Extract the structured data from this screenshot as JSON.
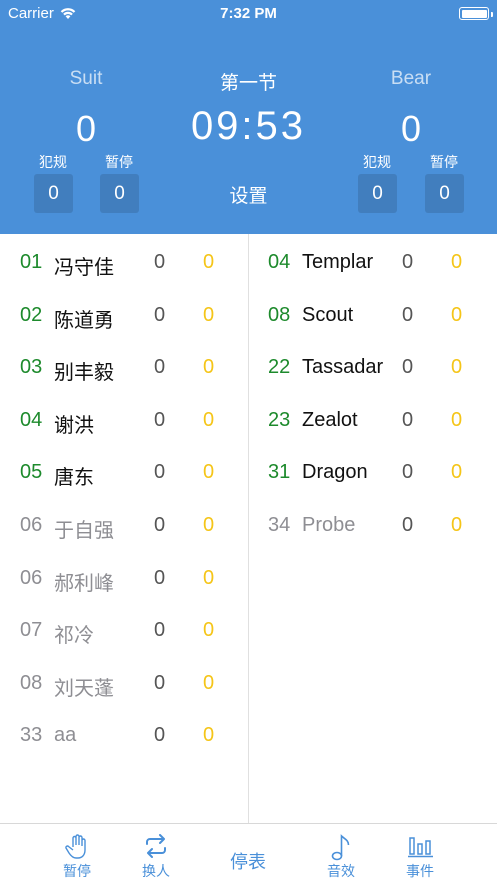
{
  "status_bar": {
    "carrier": "Carrier",
    "time": "7:32 PM"
  },
  "header": {
    "period": "第一节",
    "clock": "09:53",
    "settings_label": "设置",
    "home": {
      "name": "Suit",
      "score": "0",
      "fouls_label": "犯规",
      "fouls": "0",
      "timeouts_label": "暂停",
      "timeouts": "0"
    },
    "away": {
      "name": "Bear",
      "score": "0",
      "fouls_label": "犯规",
      "fouls": "0",
      "timeouts_label": "暂停",
      "timeouts": "0"
    }
  },
  "home_players": [
    {
      "num": "01",
      "name": "冯守佳",
      "v1": "0",
      "v2": "0",
      "active": true
    },
    {
      "num": "02",
      "name": "陈道勇",
      "v1": "0",
      "v2": "0",
      "active": true
    },
    {
      "num": "03",
      "name": "别丰毅",
      "v1": "0",
      "v2": "0",
      "active": true
    },
    {
      "num": "04",
      "name": "谢洪",
      "v1": "0",
      "v2": "0",
      "active": true
    },
    {
      "num": "05",
      "name": "唐东",
      "v1": "0",
      "v2": "0",
      "active": true
    },
    {
      "num": "06",
      "name": "于自强",
      "v1": "0",
      "v2": "0",
      "active": false
    },
    {
      "num": "06",
      "name": "郝利峰",
      "v1": "0",
      "v2": "0",
      "active": false
    },
    {
      "num": "07",
      "name": "祁冷",
      "v1": "0",
      "v2": "0",
      "active": false
    },
    {
      "num": "08",
      "name": "刘天蓬",
      "v1": "0",
      "v2": "0",
      "active": false
    },
    {
      "num": "33",
      "name": "aa",
      "v1": "0",
      "v2": "0",
      "active": false
    }
  ],
  "away_players": [
    {
      "num": "04",
      "name": "Templar",
      "v1": "0",
      "v2": "0",
      "active": true
    },
    {
      "num": "08",
      "name": "Scout",
      "v1": "0",
      "v2": "0",
      "active": true
    },
    {
      "num": "22",
      "name": "Tassadar",
      "v1": "0",
      "v2": "0",
      "active": true
    },
    {
      "num": "23",
      "name": "Zealot",
      "v1": "0",
      "v2": "0",
      "active": true
    },
    {
      "num": "31",
      "name": "Dragon",
      "v1": "0",
      "v2": "0",
      "active": true
    },
    {
      "num": "34",
      "name": "Probe",
      "v1": "0",
      "v2": "0",
      "active": false
    }
  ],
  "tabbar": {
    "timeout_label": "暂停",
    "substitute_label": "换人",
    "stop_clock_label": "停表",
    "sound_label": "音效",
    "events_label": "事件"
  },
  "colors": {
    "accent": "#4a90d9",
    "active_number": "#1d8a2c",
    "secondary_stat": "#f5c518"
  }
}
